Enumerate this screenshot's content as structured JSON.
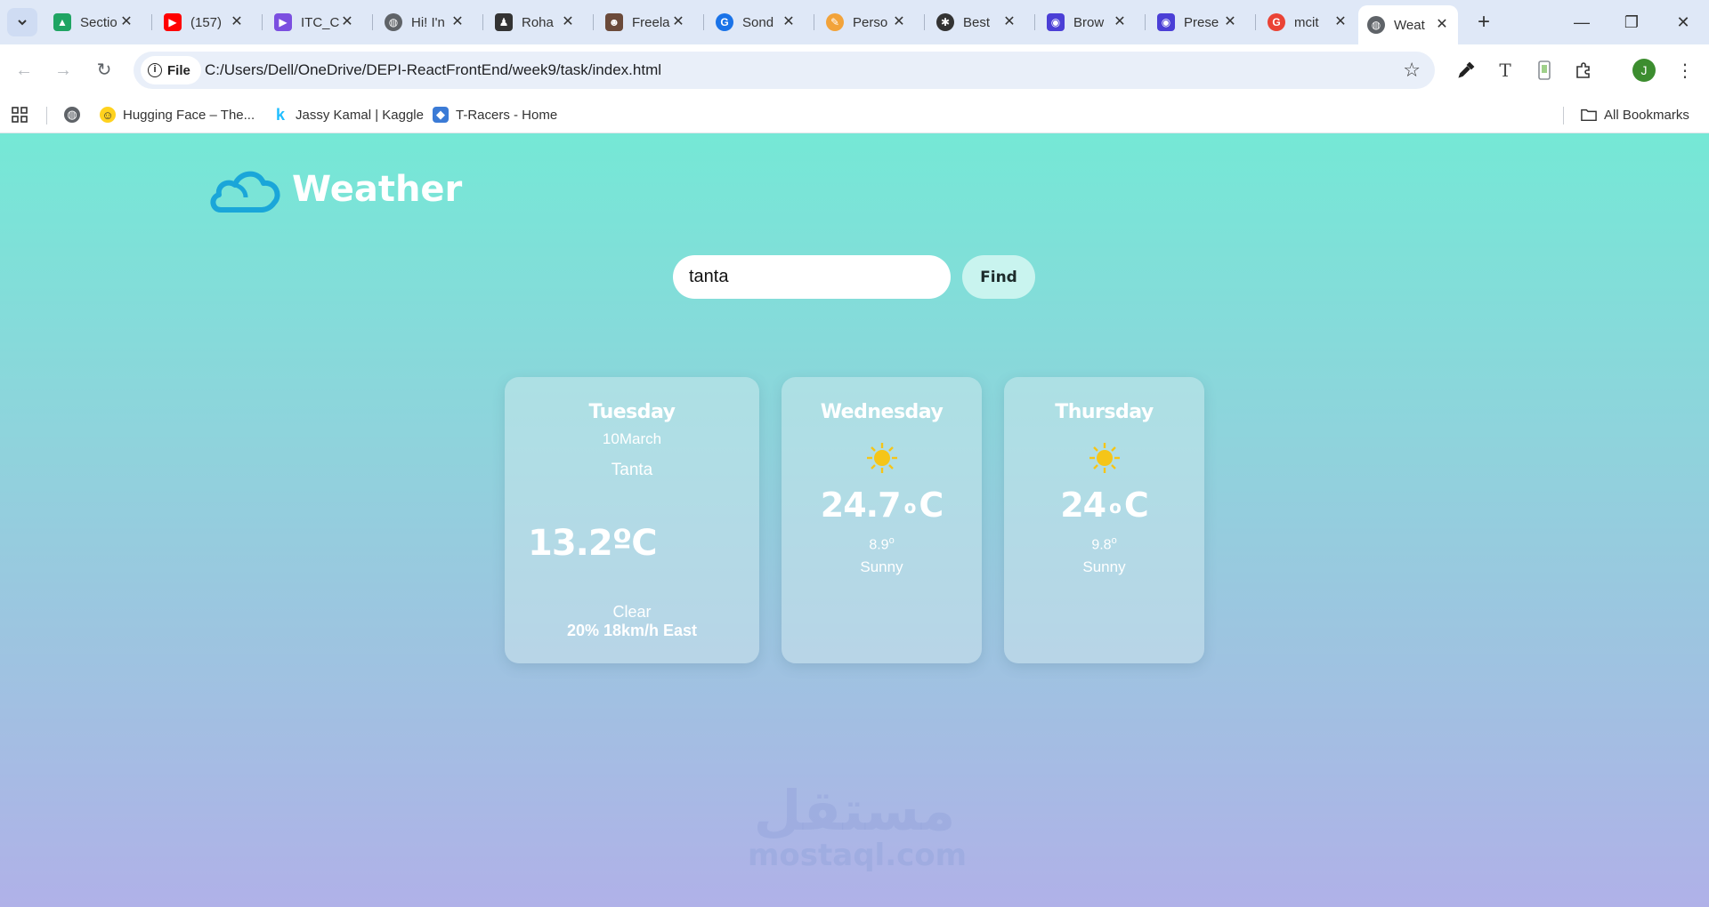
{
  "browser": {
    "tabs": [
      {
        "title": "Sectio",
        "icon": "google-drive-icon",
        "color": "#1fa463"
      },
      {
        "title": "(157)",
        "icon": "youtube-icon",
        "color": "#ff0000"
      },
      {
        "title": "ITC_C",
        "icon": "video-play-icon",
        "color": "#7b4fe0"
      },
      {
        "title": "Hi! I'n",
        "icon": "globe-icon",
        "color": "#5f6368"
      },
      {
        "title": "Roha",
        "icon": "person-icon",
        "color": "#333333"
      },
      {
        "title": "Freela",
        "icon": "person-photo-icon",
        "color": "#6b4a3a"
      },
      {
        "title": "Sond",
        "icon": "google-g-icon",
        "color": "#1a73e8"
      },
      {
        "title": "Perso",
        "icon": "pen-icon",
        "color": "#f2a33a"
      },
      {
        "title": "Best",
        "icon": "openai-icon",
        "color": "#333333"
      },
      {
        "title": "Brow",
        "icon": "presenter-icon",
        "color": "#4b3fd6"
      },
      {
        "title": "Prese",
        "icon": "presenter-icon",
        "color": "#4b3fd6"
      },
      {
        "title": "mcit",
        "icon": "google-g-icon",
        "color": "#ea4335"
      },
      {
        "title": "Weat",
        "icon": "globe-icon",
        "color": "#5f6368",
        "active": true
      }
    ],
    "new_tab": "+",
    "chip_label": "File",
    "url": "C:/Users/Dell/OneDrive/DEPI-ReactFrontEnd/week9/task/index.html",
    "avatar_letter": "J",
    "bookmarks": [
      {
        "label": "Hugging Face – The...",
        "icon": "hugging-face-icon"
      },
      {
        "label": "Jassy Kamal | Kaggle",
        "icon": "kaggle-icon"
      },
      {
        "label": "T-Racers - Home",
        "icon": "t-racers-icon"
      }
    ],
    "all_bookmarks": "All Bookmarks"
  },
  "app": {
    "title": "Weather",
    "search": {
      "value": "tanta"
    },
    "find_label": "Find"
  },
  "forecast": {
    "today": {
      "day": "Tuesday",
      "date": "10March",
      "city": "Tanta",
      "temp": "13.2ºC",
      "icon": "crescent-moon-icon",
      "condition": "Clear",
      "wind": "20% 18km/h East"
    },
    "next": [
      {
        "day": "Wednesday",
        "max": "24.7",
        "deg": "o",
        "unit": "C",
        "min": "8.9",
        "min_deg": "o",
        "condition": "Sunny",
        "icon": "sun-icon"
      },
      {
        "day": "Thursday",
        "max": "24",
        "deg": "o",
        "unit": "C",
        "min": "9.8",
        "min_deg": "o",
        "condition": "Sunny",
        "icon": "sun-icon"
      }
    ]
  },
  "watermark": {
    "arabic": "مستقل",
    "latin": "mostaql.com"
  },
  "colors": {
    "accent_cloud": "#1aa6d9",
    "sun": "#f5c518",
    "moon": "#1f7fc6"
  }
}
